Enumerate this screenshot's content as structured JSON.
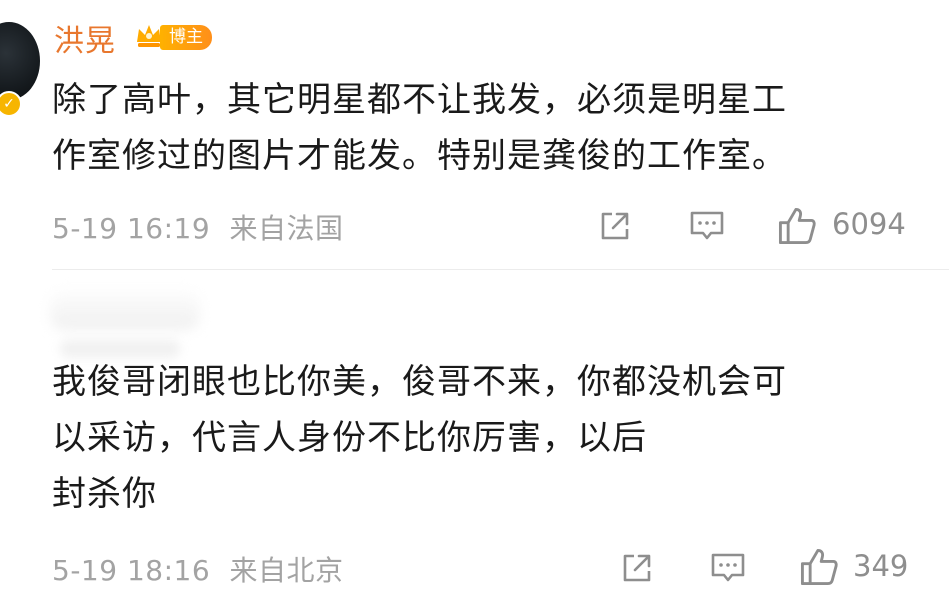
{
  "post": {
    "username": "洪晃",
    "badge": "博主",
    "text_lines": [
      "除了高叶，其它明星都不让我发，必须是明星工",
      "作室修过的图片才能发。特别是龚俊的工作室。"
    ],
    "timestamp": "5-19 16:19",
    "source": "来自法国",
    "likes": "6094"
  },
  "reply": {
    "text_lines": [
      "我俊哥闭眼也比你美，俊哥不来，你都没机会可",
      "以采访，代言人身份不比你厉害，以后",
      "封杀你"
    ],
    "timestamp": "5-19 18:16",
    "source": "来自北京",
    "likes": "349"
  },
  "icons": [
    "share-icon",
    "comment-icon",
    "like-icon",
    "verified-icon",
    "crown-icon"
  ],
  "colors": {
    "username": "#e8772e",
    "badge": "#ffa510",
    "meta_text": "#a3a3a3",
    "icon": "#8e8e8e"
  }
}
